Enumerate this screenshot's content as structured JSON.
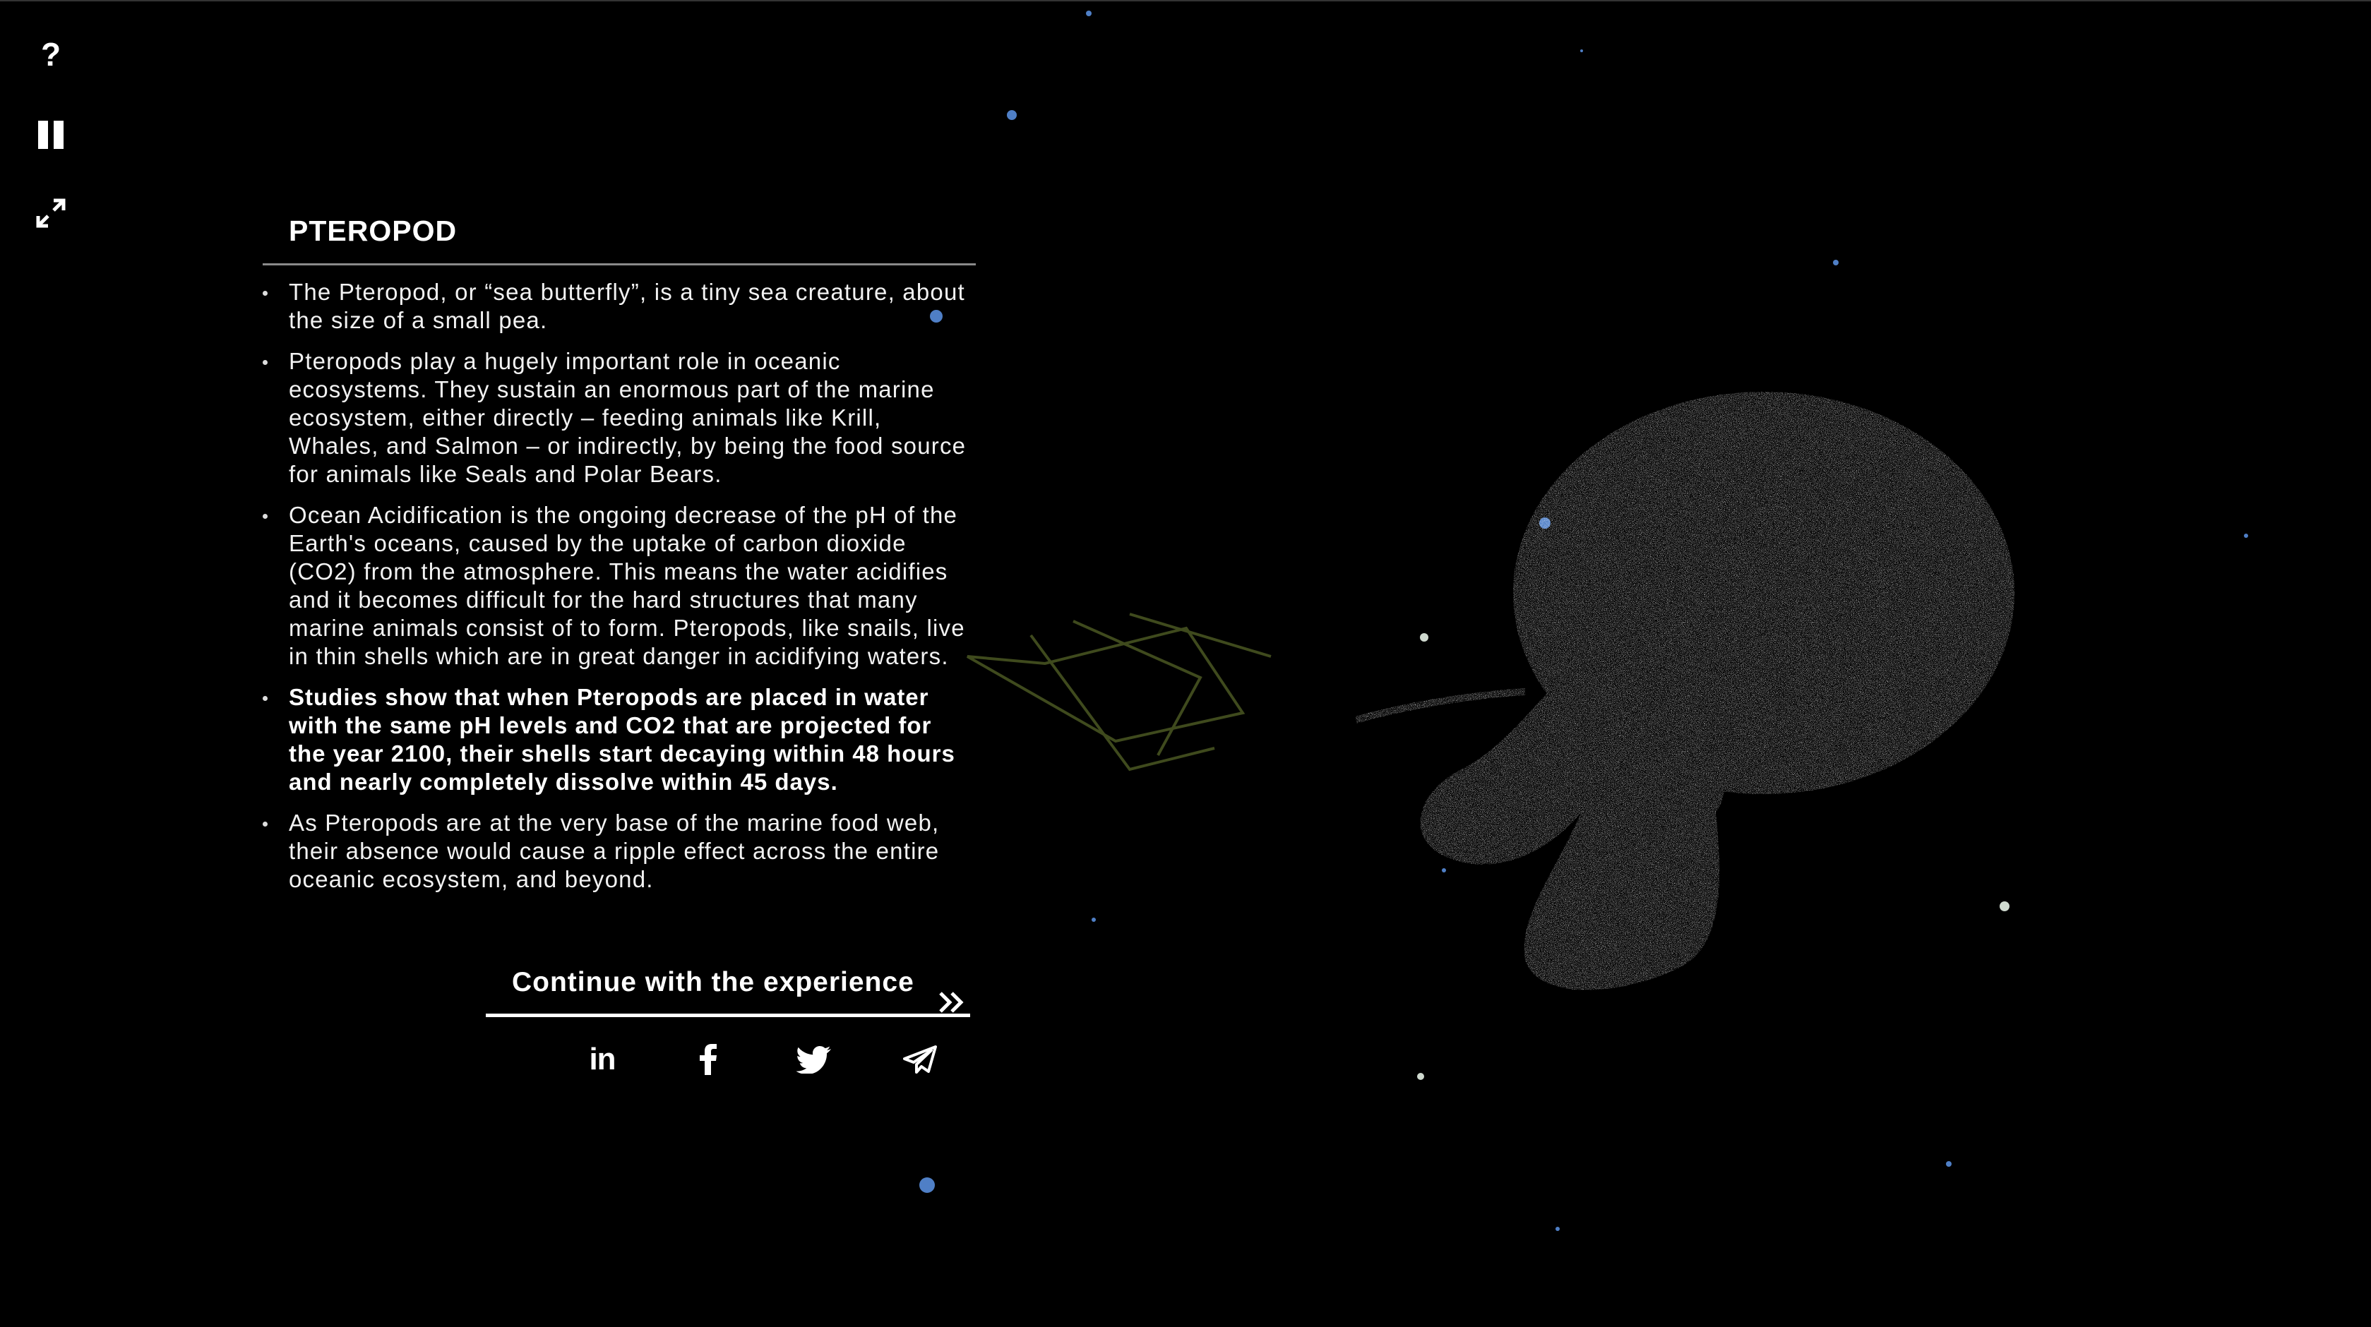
{
  "controls": {
    "help_label": "?",
    "pause_icon": "pause-icon",
    "fullscreen_icon": "expand-icon"
  },
  "panel": {
    "title": "PTEROPOD",
    "bullets": [
      "The Pteropod, or “sea butterfly”, is a tiny sea creature, about the size of a small pea.",
      "Pteropods play a hugely important role in oceanic ecosystems. They sustain an enormous part of the marine ecosystem, either directly – feeding animals like Krill, Whales, and Salmon – or indirectly, by being the food source for animals like Seals and Polar Bears.",
      "Ocean Acidification is the ongoing decrease of the pH of the Earth's oceans, caused by the uptake of carbon dioxide (CO2) from the atmosphere. This means the water acidifies and it becomes difficult for the hard structures that many marine animals consist of to form. Pteropods, like snails, live in thin shells which are in great danger in acidifying waters.",
      "Studies show that when Pteropods are placed in water with the same pH levels and CO2 that are projected for the year 2100, their shells start decaying within 48 hours and nearly completely dissolve within 45 days.",
      "As Pteropods are at the very base of the marine food web, their absence would cause a ripple effect across the entire oceanic ecosystem, and beyond."
    ],
    "continue_label": "Continue with the experience"
  },
  "share": {
    "linkedin_label": "in",
    "icons": [
      "linkedin-icon",
      "facebook-icon",
      "twitter-icon",
      "telegram-icon"
    ]
  },
  "colors": {
    "background": "#000000",
    "text": "#ffffff",
    "particle_blue": "#4f7fc6",
    "creature_gray": "#c8c8c8"
  }
}
